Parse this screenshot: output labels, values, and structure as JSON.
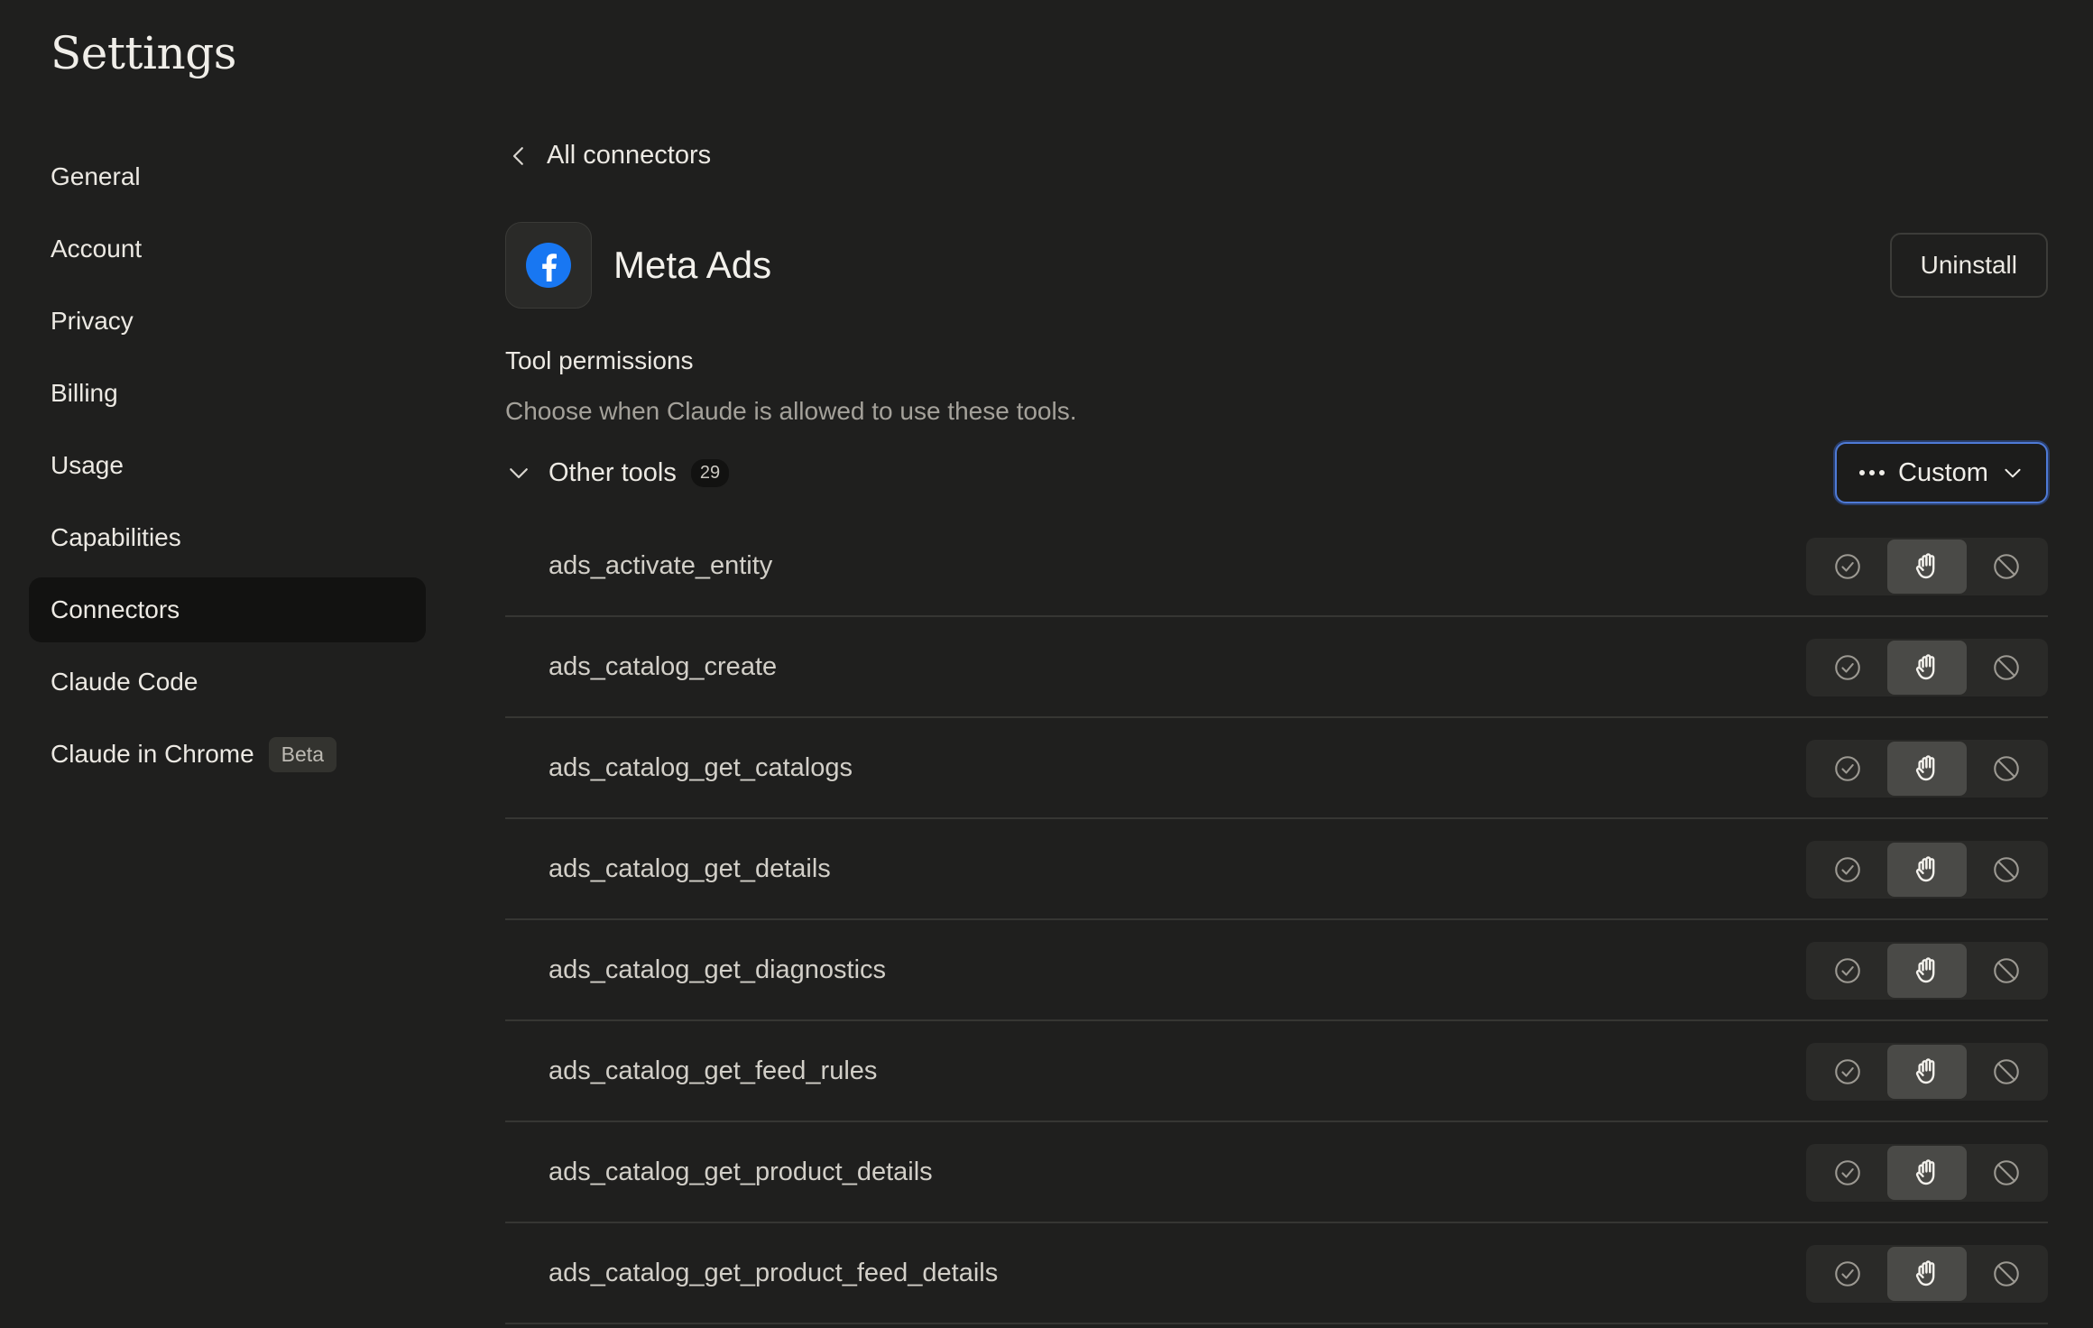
{
  "app": {
    "title": "Settings"
  },
  "sidebar": {
    "items": [
      {
        "label": "General"
      },
      {
        "label": "Account"
      },
      {
        "label": "Privacy"
      },
      {
        "label": "Billing"
      },
      {
        "label": "Usage"
      },
      {
        "label": "Capabilities"
      },
      {
        "label": "Connectors",
        "active": true
      },
      {
        "label": "Claude Code"
      },
      {
        "label": "Claude in Chrome",
        "badge": "Beta"
      }
    ]
  },
  "breadcrumb": {
    "label": "All connectors",
    "icon": "chevron-left-icon"
  },
  "connector": {
    "name": "Meta Ads",
    "icon": "facebook-logo-icon",
    "brand_color": "#1877F2",
    "uninstall_label": "Uninstall"
  },
  "permissions": {
    "title": "Tool permissions",
    "description": "Choose when Claude is allowed to use these tools.",
    "group": {
      "label": "Other tools",
      "count": "29",
      "mode_label": "Custom",
      "mode_icon": "more-dots-icon"
    },
    "tools": [
      {
        "name": "ads_activate_entity",
        "selected": "ask"
      },
      {
        "name": "ads_catalog_create",
        "selected": "ask"
      },
      {
        "name": "ads_catalog_get_catalogs",
        "selected": "ask"
      },
      {
        "name": "ads_catalog_get_details",
        "selected": "ask"
      },
      {
        "name": "ads_catalog_get_diagnostics",
        "selected": "ask"
      },
      {
        "name": "ads_catalog_get_feed_rules",
        "selected": "ask"
      },
      {
        "name": "ads_catalog_get_product_details",
        "selected": "ask"
      },
      {
        "name": "ads_catalog_get_product_feed_details",
        "selected": "ask"
      }
    ],
    "options": [
      {
        "key": "allow",
        "icon": "check-circle-icon"
      },
      {
        "key": "ask",
        "icon": "hand-icon"
      },
      {
        "key": "block",
        "icon": "block-icon"
      }
    ]
  },
  "colors": {
    "background": "#1f1f1e",
    "active_nav": "#121211",
    "focus_ring": "#4e7ad6"
  }
}
